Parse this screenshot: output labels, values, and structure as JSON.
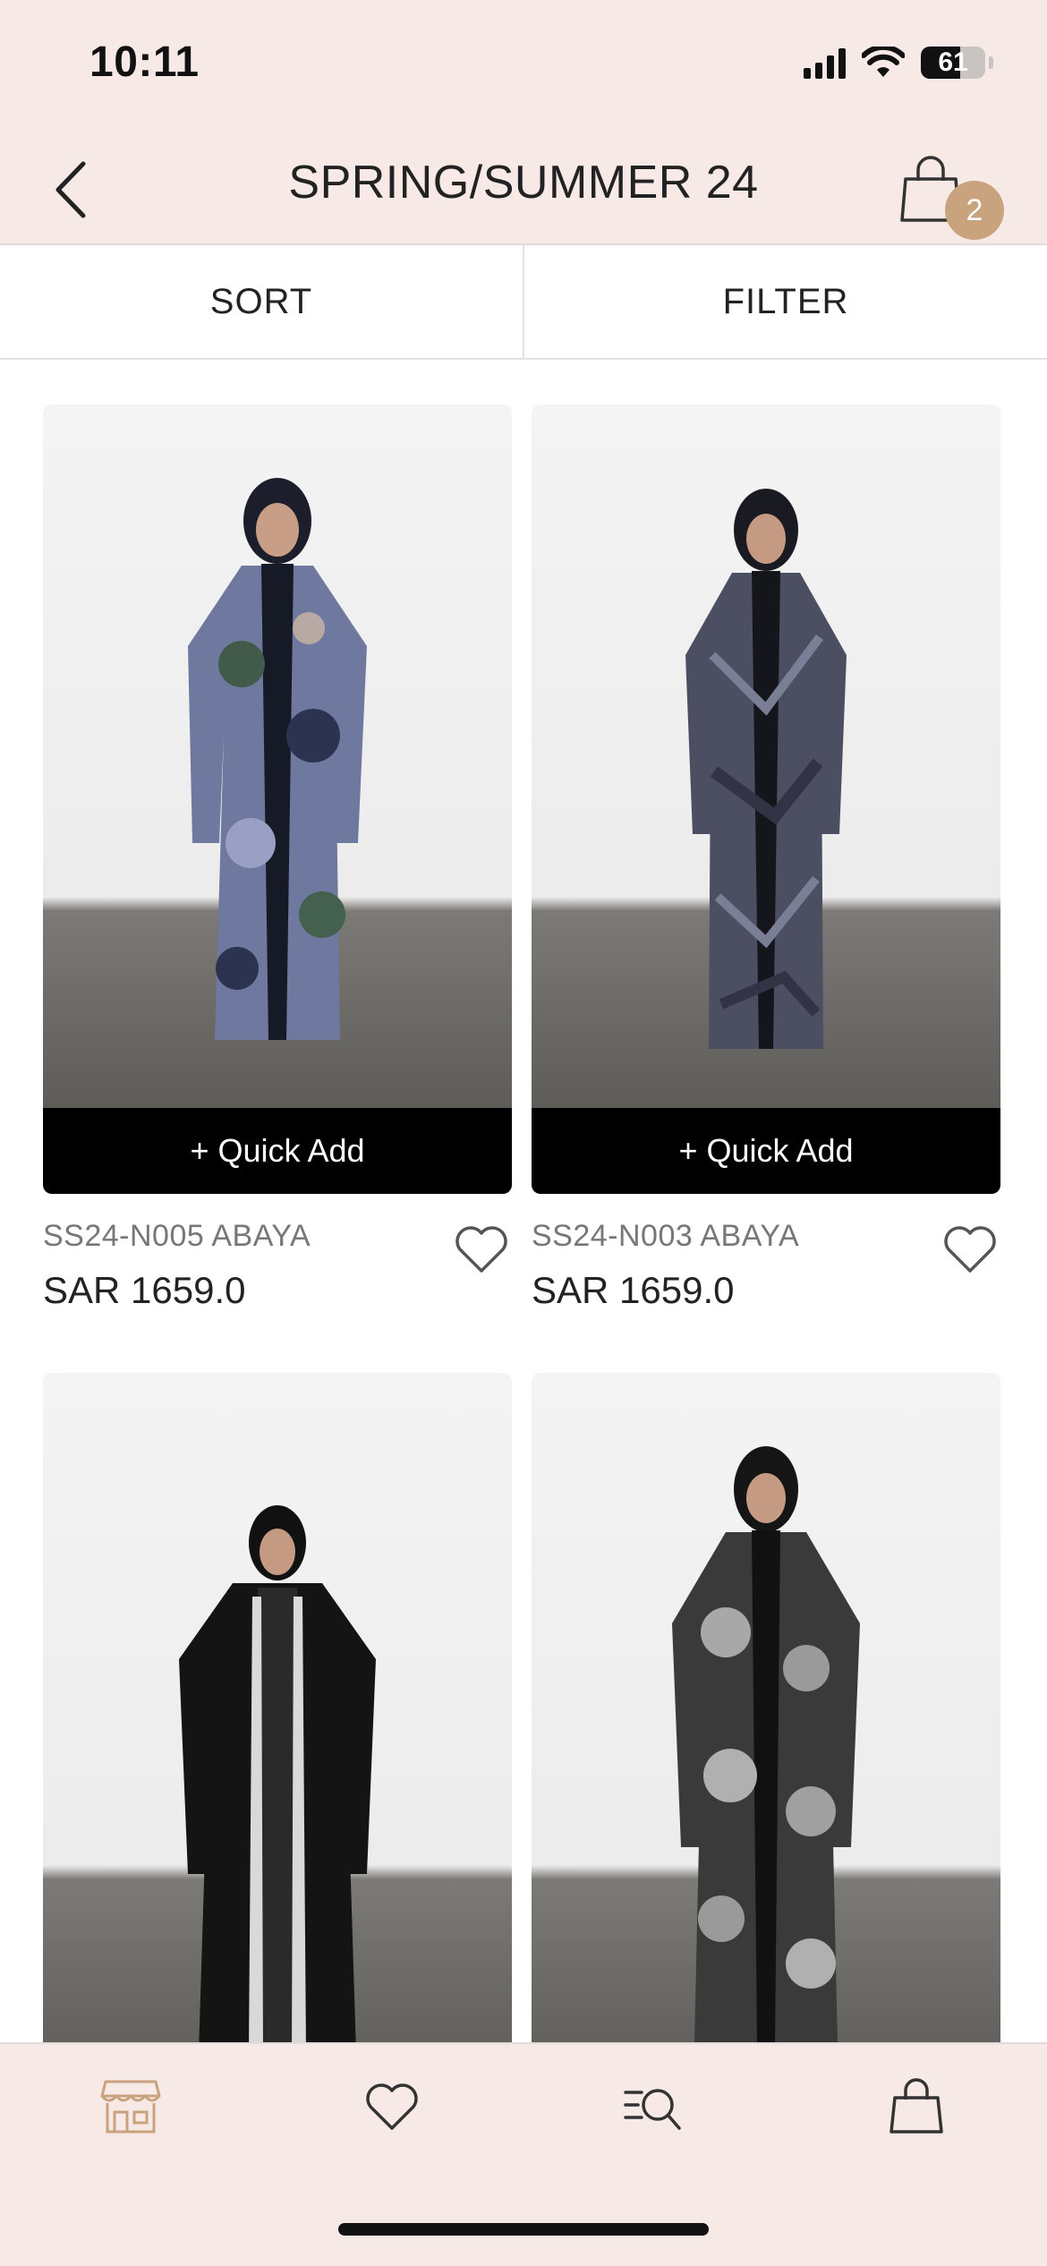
{
  "status": {
    "time": "10:11",
    "battery": "61",
    "battery_fraction": 0.61
  },
  "header": {
    "title": "SPRING/SUMMER 24",
    "cart_count": "2"
  },
  "toolbar": {
    "sort_label": "SORT",
    "filter_label": "FILTER"
  },
  "products": [
    {
      "name": "SS24-N005 ABAYA",
      "price": "SAR 1659.0",
      "quick_add": "+ Quick Add"
    },
    {
      "name": "SS24-N003 ABAYA",
      "price": "SAR 1659.0",
      "quick_add": "+ Quick Add"
    },
    {
      "name": "",
      "price": "",
      "quick_add": ""
    },
    {
      "name": "",
      "price": "",
      "quick_add": ""
    }
  ],
  "tabs": [
    {
      "icon": "store-icon"
    },
    {
      "icon": "heart-icon"
    },
    {
      "icon": "search-list-icon"
    },
    {
      "icon": "bag-icon"
    }
  ],
  "colors": {
    "header_bg": "#f7e9e6",
    "accent": "#c9a27e",
    "quick_add_bg": "#000000"
  }
}
